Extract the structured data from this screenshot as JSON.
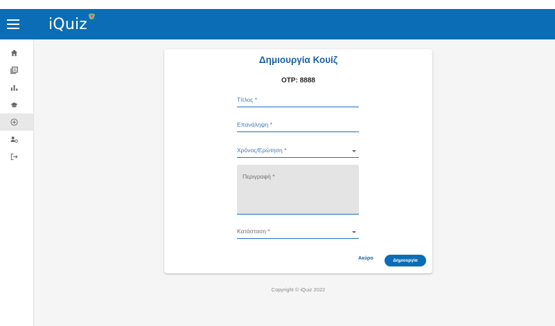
{
  "app": {
    "title": "iQuiz"
  },
  "colors": {
    "primary": "#0b6db5",
    "title": "#1b5fa6"
  },
  "sidebar": {
    "items": [
      {
        "icon": "home-icon"
      },
      {
        "icon": "library-icon"
      },
      {
        "icon": "bar-chart-icon"
      },
      {
        "icon": "graduation-cap-icon"
      },
      {
        "icon": "add-circle-icon",
        "active": true
      },
      {
        "icon": "manage-accounts-icon"
      },
      {
        "icon": "logout-icon"
      }
    ]
  },
  "form": {
    "title": "Δημιουργία Κουίζ",
    "otp": "OTP: 8888",
    "fields": {
      "title": "Τίτλος *",
      "repeat": "Επανάληψη *",
      "time_per_question": "Χρόνος/Ερώτηση *",
      "description": "Περιγραφή *",
      "status": "Κατάσταση *"
    },
    "cancel_label": "Ακύρο",
    "create_label": "Δημιουργία"
  },
  "footer": {
    "copyright": "Copyright © iQuiz 2022"
  }
}
